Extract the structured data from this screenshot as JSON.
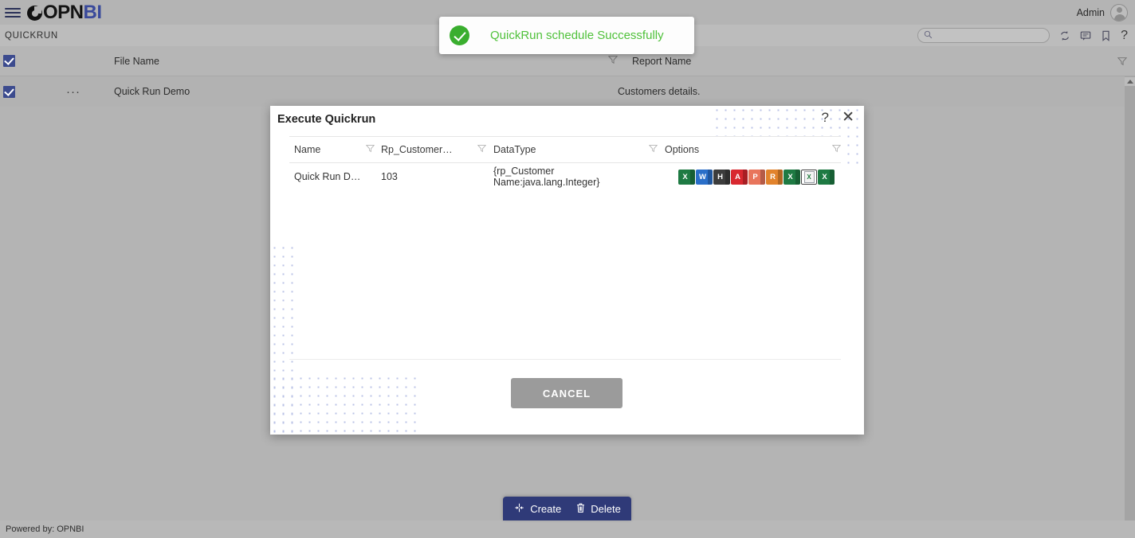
{
  "app": {
    "logo_dark": "OPN",
    "logo_blue": "BI",
    "breadcrumb": "QUICKRUN",
    "footer_text": "Powered by: OPNBI"
  },
  "header": {
    "user_label": "Admin",
    "icons": [
      "menu-icon",
      "avatar-icon"
    ]
  },
  "search": {
    "value": "",
    "placeholder": ""
  },
  "toolbar_icons": {
    "refresh": "refresh-icon",
    "comment": "comment-icon",
    "bookmark": "bookmark-icon",
    "help": "?"
  },
  "grid": {
    "columns": [
      "File Name",
      "Report Name"
    ],
    "rows": [
      {
        "checked": true,
        "menu": "···",
        "file_name": "Quick Run Demo",
        "report_name": "Customers details."
      }
    ],
    "header_checked": true
  },
  "toast": {
    "message": "QuickRun schedule Successfully",
    "type": "success",
    "color": "#4fc13a"
  },
  "modal": {
    "title": "Execute Quickrun",
    "help_label": "?",
    "close_label": "✕",
    "columns": [
      "Name",
      "Rp_Customer…",
      "DataType",
      "Options"
    ],
    "rows": [
      {
        "name": "Quick Run D…",
        "rp_customer": "103",
        "datatype": "{rp_Customer Name:java.lang.Integer}",
        "options": [
          {
            "label": "X",
            "name": "export-excel-icon",
            "color": "#1e7a43",
            "selected": false
          },
          {
            "label": "W",
            "name": "export-word-icon",
            "color": "#2a6fc9",
            "selected": false
          },
          {
            "label": "H",
            "name": "export-html-icon",
            "color": "#3c3c3c",
            "selected": false
          },
          {
            "label": "A",
            "name": "export-pdf-icon",
            "color": "#d8282f",
            "selected": false
          },
          {
            "label": "P",
            "name": "export-powerpoint-icon",
            "color": "#e8755c",
            "selected": false
          },
          {
            "label": "R",
            "name": "export-rtf-icon",
            "color": "#e2832c",
            "selected": false
          },
          {
            "label": "X",
            "name": "export-xls-icon",
            "color": "#1e7a43",
            "selected": false
          },
          {
            "label": "X",
            "name": "export-xlsx-selected-icon",
            "color": "#ffffff",
            "selected": true
          },
          {
            "label": "X",
            "name": "export-csv-icon",
            "color": "#1e7a43",
            "selected": false
          }
        ]
      }
    ],
    "cancel_label": "CANCEL"
  },
  "action_bar": {
    "create_label": "Create",
    "delete_label": "Delete"
  }
}
